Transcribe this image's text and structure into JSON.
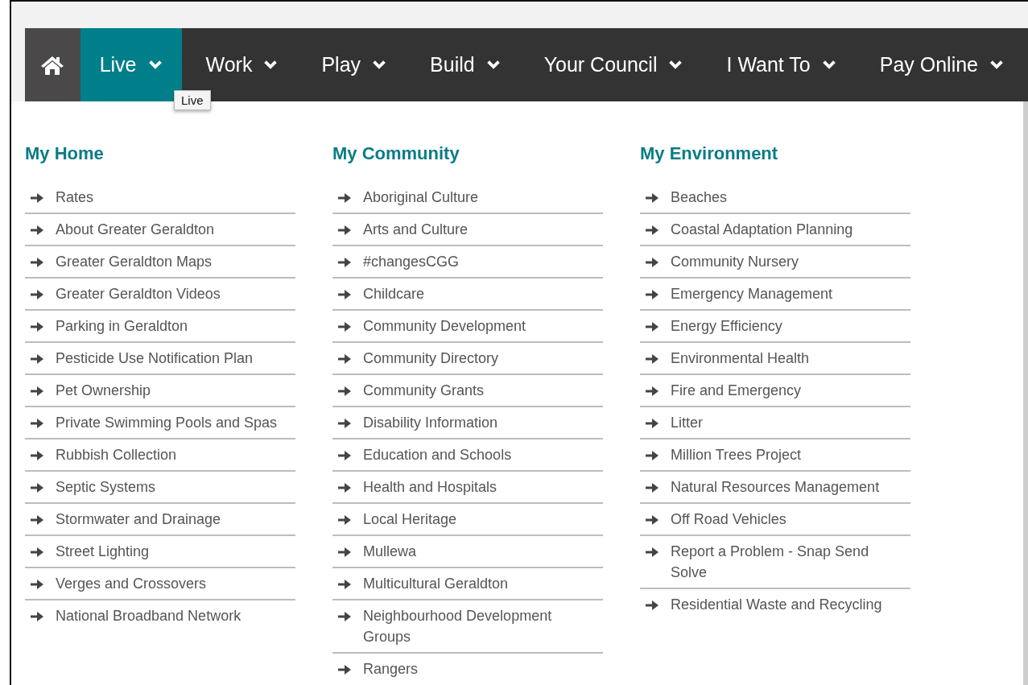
{
  "nav": [
    {
      "kind": "home",
      "selected": false
    },
    {
      "kind": "menu",
      "label": "Live",
      "selected": true
    },
    {
      "kind": "menu",
      "label": "Work",
      "selected": false
    },
    {
      "kind": "menu",
      "label": "Play",
      "selected": false
    },
    {
      "kind": "menu",
      "label": "Build",
      "selected": false
    },
    {
      "kind": "menu",
      "label": "Your Council",
      "selected": false
    },
    {
      "kind": "menu",
      "label": "I Want To",
      "selected": false
    },
    {
      "kind": "menu",
      "label": "Pay Online",
      "selected": false
    }
  ],
  "tooltip": "Live",
  "columns": [
    {
      "heading": "My Home",
      "items": [
        "Rates",
        "About Greater Geraldton",
        "Greater Geraldton Maps",
        "Greater Geraldton Videos",
        "Parking in Geraldton",
        "Pesticide Use Notification Plan",
        "Pet Ownership",
        "Private Swimming Pools and Spas",
        "Rubbish Collection",
        "Septic Systems",
        "Stormwater and Drainage",
        "Street Lighting",
        "Verges and Crossovers",
        "National Broadband Network"
      ]
    },
    {
      "heading": "My Community",
      "items": [
        "Aboriginal Culture",
        "Arts and Culture",
        "#changesCGG",
        "Childcare",
        "Community Development",
        "Community Directory",
        "Community Grants",
        "Disability Information",
        "Education and Schools",
        "Health and Hospitals",
        "Local Heritage",
        "Mullewa",
        "Multicultural Geraldton",
        "Neighbourhood Development Groups",
        "Rangers"
      ]
    },
    {
      "heading": "My Environment",
      "items": [
        "Beaches",
        "Coastal Adaptation Planning",
        "Community Nursery",
        "Emergency Management",
        "Energy Efficiency",
        "Environmental Health",
        "Fire and Emergency",
        "Litter",
        "Million Trees Project",
        "Natural Resources Management",
        "Off Road Vehicles",
        "Report a Problem - Snap Send Solve",
        "Residential Waste and Recycling"
      ]
    }
  ]
}
